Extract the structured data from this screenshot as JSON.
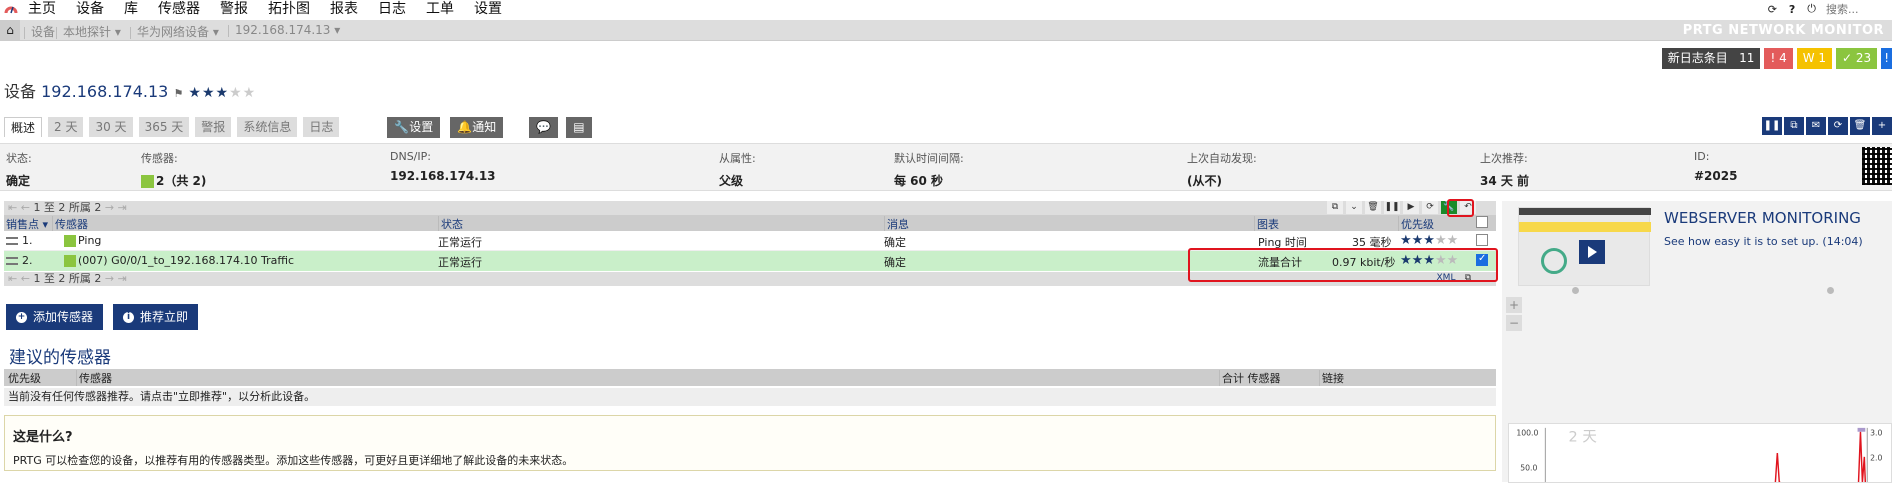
{
  "topnav": {
    "items": [
      "主页",
      "设备",
      "库",
      "传感器",
      "警报",
      "拓扑图",
      "报表",
      "日志",
      "工单",
      "设置"
    ],
    "search_placeholder": "搜索..."
  },
  "breadcrumb": {
    "items": [
      "设备",
      "本地探针 ▾",
      "华为网络设备 ▾",
      "192.168.174.13 ▾"
    ],
    "brand": "PRTG NETWORK MONITOR"
  },
  "status_boxes": [
    {
      "label": "新日志条目",
      "count": "11",
      "color": "#444444"
    },
    {
      "label": "! 4",
      "color": "#e35b5b"
    },
    {
      "label": "W 1",
      "color": "#f5c200"
    },
    {
      "label": "✓ 23",
      "color": "#8bc53f"
    },
    {
      "label": "!",
      "color": "#1a6ee0"
    }
  ],
  "device": {
    "prefix": "设备",
    "ip": "192.168.174.13",
    "stars_on": 3,
    "stars_total": 5
  },
  "tabs": [
    "概述",
    "2 天",
    "30 天",
    "365 天",
    "警报",
    "系统信息",
    "日志"
  ],
  "tab_buttons": [
    "设置",
    "通知"
  ],
  "info": {
    "status": {
      "label": "状态:",
      "value": "确定"
    },
    "sensors": {
      "label": "传感器:",
      "value": "2（共 2)"
    },
    "dns": {
      "label": "DNS/IP:",
      "value": "192.168.174.13"
    },
    "dependency": {
      "label": "从属性:",
      "value": "父级"
    },
    "interval": {
      "label": "默认时间间隔:",
      "value": "每 60 秒"
    },
    "last_discovery": {
      "label": "上次自动发现:",
      "value": "(从不)"
    },
    "last_recommend": {
      "label": "上次推荐:",
      "value": "34 天 前"
    },
    "id": {
      "label": "ID:",
      "value": "#2025"
    }
  },
  "pager": {
    "text": "1 至 2 所属 2",
    "xml": "XML"
  },
  "table": {
    "headers": [
      "销售点 ▾",
      "传感器",
      "状态",
      "消息",
      "图表",
      "优先级"
    ],
    "rows": [
      {
        "pos": "1.",
        "sensor": "Ping",
        "status": "正常运行",
        "message": "确定",
        "chart_label": "Ping 时间",
        "chart_value": "35 毫秒",
        "stars_on": 3,
        "checked": false
      },
      {
        "pos": "2.",
        "sensor": "(007) G0/0/1_to_192.168.174.10 Traffic",
        "status": "正常运行",
        "message": "确定",
        "chart_label": "流量合计",
        "chart_value": "0.97 kbit/秒",
        "stars_on": 3,
        "checked": true
      }
    ]
  },
  "buttons": {
    "add_sensor": "添加传感器",
    "recommend_now": "推荐立即"
  },
  "suggested": {
    "title": "建议的传感器",
    "headers": [
      "优先级",
      "传感器",
      "合计 传感器",
      "链接"
    ],
    "empty_text": "当前没有任何传感器推荐。请点击\"立即推荐\"，以分析此设备。",
    "what_title": "这是什么?",
    "what_text": "PRTG 可以检查您的设备，以推荐有用的传感器类型。添加这些传感器，可更好且更详细地了解此设备的未来状态。"
  },
  "promo": {
    "title": "WEBSERVER MONITORING",
    "subtitle": "See how easy it is to set up. (14:04)"
  },
  "mini_chart": {
    "label": "2 天",
    "y_left": [
      "100.0",
      "50.0"
    ],
    "y_right": [
      "3.0",
      "2.0"
    ]
  }
}
